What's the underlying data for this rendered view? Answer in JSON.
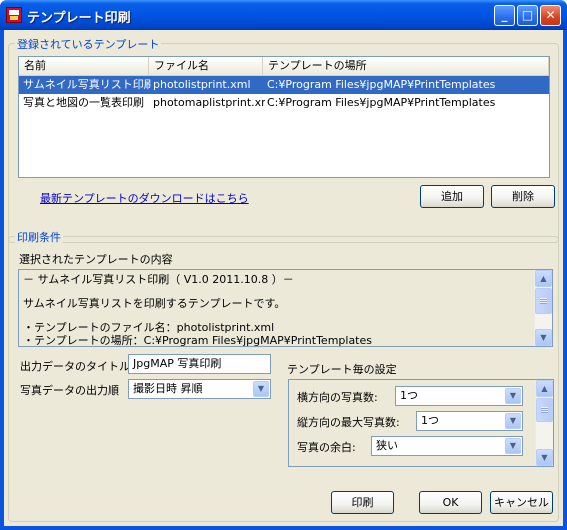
{
  "window": {
    "title": "テンプレート印刷",
    "minimize_glyph": "_",
    "maximize_glyph": "□",
    "close_glyph": "✕"
  },
  "templates_group": {
    "label": "登録されているテンプレート",
    "columns": [
      "名前",
      "ファイル名",
      "テンプレートの場所"
    ],
    "rows": [
      {
        "name": "サムネイル写真リスト印刷",
        "file": "photolistprint.xml",
        "location": "C:¥Program Files¥jpgMAP¥PrintTemplates",
        "selected": true
      },
      {
        "name": "写真と地図の一覧表印刷",
        "file": "photomaplistprint.xml",
        "location": "C:¥Program Files¥jpgMAP¥PrintTemplates",
        "selected": false
      }
    ],
    "download_link": "最新テンプレートのダウンロードはこちら",
    "add_label": "追加",
    "delete_label": "削除"
  },
  "print_group": {
    "label": "印刷条件",
    "selected_content_label": "選択されたテンプレートの内容",
    "description_lines": [
      "－ サムネイル写真リスト印刷（ V1.0  2011.10.8 ）－",
      "",
      "サムネイル写真リストを印刷するテンプレートです。",
      "",
      "・テンプレートのファイル名：photolistprint.xml",
      "・テンプレートの場所：C:¥Program Files¥jpgMAP¥PrintTemplates"
    ],
    "output_title_label": "出力データのタイトル",
    "output_title_value": "JpgMAP 写真印刷",
    "output_order_label": "写真データの出力順",
    "output_order_value": "撮影日時 昇順",
    "template_settings_label": "テンプレート毎の設定",
    "settings": [
      {
        "label": "横方向の写真数:",
        "value": "1つ"
      },
      {
        "label": "縦方向の最大写真数:",
        "value": "1つ"
      },
      {
        "label": "写真の余白:",
        "value": "狭い"
      }
    ]
  },
  "footer": {
    "print_label": "印刷",
    "ok_label": "OK",
    "cancel_label": "キャンセル"
  },
  "icons": {
    "scroll_up": "▲",
    "scroll_down": "▼",
    "dropdown": "▼"
  }
}
